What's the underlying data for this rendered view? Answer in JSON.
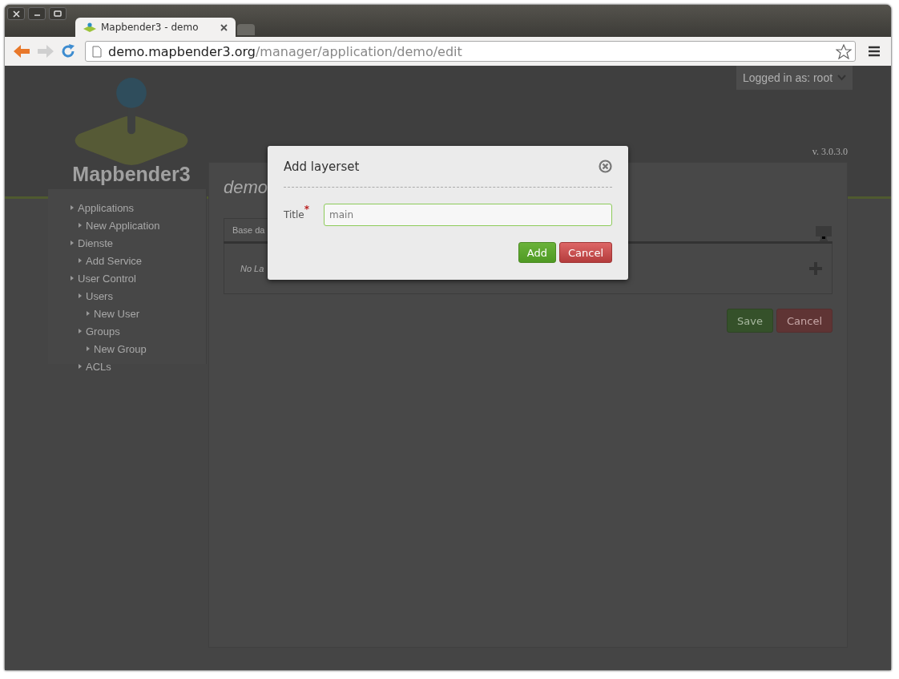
{
  "browser": {
    "tabs": [
      {
        "title": "Mapbender3 - demo",
        "selected": true
      }
    ],
    "url": {
      "host": "demo.mapbender3.org",
      "path": "/manager/application/demo/edit"
    }
  },
  "header": {
    "logo_text": "Mapbender3",
    "user_menu": "Logged in as: root",
    "version": "v. 3.0.3.0"
  },
  "sidebar": {
    "items": [
      {
        "label": "Applications",
        "children": [
          {
            "label": "New Application"
          }
        ]
      },
      {
        "label": "Dienste",
        "children": [
          {
            "label": "Add Service"
          }
        ]
      },
      {
        "label": "User Control",
        "children": [
          {
            "label": "Users",
            "children": [
              {
                "label": "New User"
              }
            ]
          },
          {
            "label": "Groups",
            "children": [
              {
                "label": "New Group"
              }
            ]
          },
          {
            "label": "ACLs"
          }
        ]
      }
    ]
  },
  "main": {
    "title": "demo",
    "tabs": [
      {
        "label": "Base da",
        "selected": true
      }
    ],
    "empty_text": "No La",
    "buttons": [
      {
        "label": "Save",
        "kind": "primary"
      },
      {
        "label": "Cancel",
        "kind": "danger"
      }
    ]
  },
  "dialog": {
    "title": "Add layerset",
    "field": {
      "label": "Title",
      "required": true,
      "required_mark": "*",
      "value": "main"
    },
    "buttons": [
      {
        "label": "Add",
        "kind": "primary"
      },
      {
        "label": "Cancel",
        "kind": "danger"
      }
    ]
  }
}
